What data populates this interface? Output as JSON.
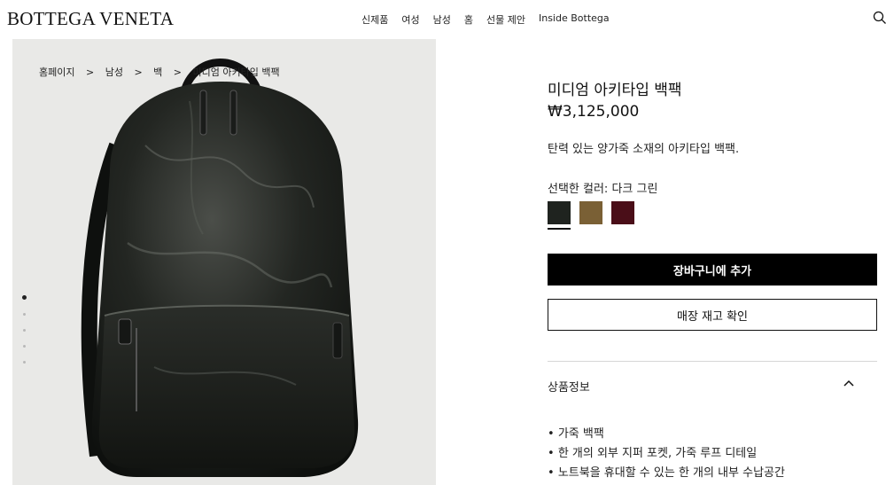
{
  "brand": {
    "logo": "BOTTEGA VENETA"
  },
  "nav": {
    "items": [
      "신제품",
      "여성",
      "남성",
      "홈",
      "선물 제안",
      "Inside Bottega"
    ]
  },
  "breadcrumb": {
    "items": [
      "홈페이지",
      ">",
      "남성",
      ">",
      "백",
      ">",
      "미디엄 아키타입 백팩"
    ]
  },
  "gallery": {
    "image_count": 5,
    "active_index": 0
  },
  "product": {
    "name": "미디엄 아키타입 백팩",
    "price": "₩3,125,000",
    "description": "탄력 있는 양가죽 소재의 아키타입 백팩.",
    "color_label": "선택한 컬러: 다크 그린",
    "swatches": [
      {
        "name": "dark-green",
        "color": "#1f231f",
        "selected": true
      },
      {
        "name": "brown",
        "color": "#7a6035",
        "selected": false
      },
      {
        "name": "burgundy",
        "color": "#4a0e18",
        "selected": false
      }
    ]
  },
  "actions": {
    "add_to_cart": "장바구니에 추가",
    "check_store": "매장 재고 확인"
  },
  "details": {
    "title": "상품정보",
    "features": [
      "가죽 백팩",
      "한 개의 외부 지퍼 포켓, 가죽 루프 디테일",
      "노트북을 휴대할 수 있는 한 개의 내부 수납공간"
    ]
  }
}
